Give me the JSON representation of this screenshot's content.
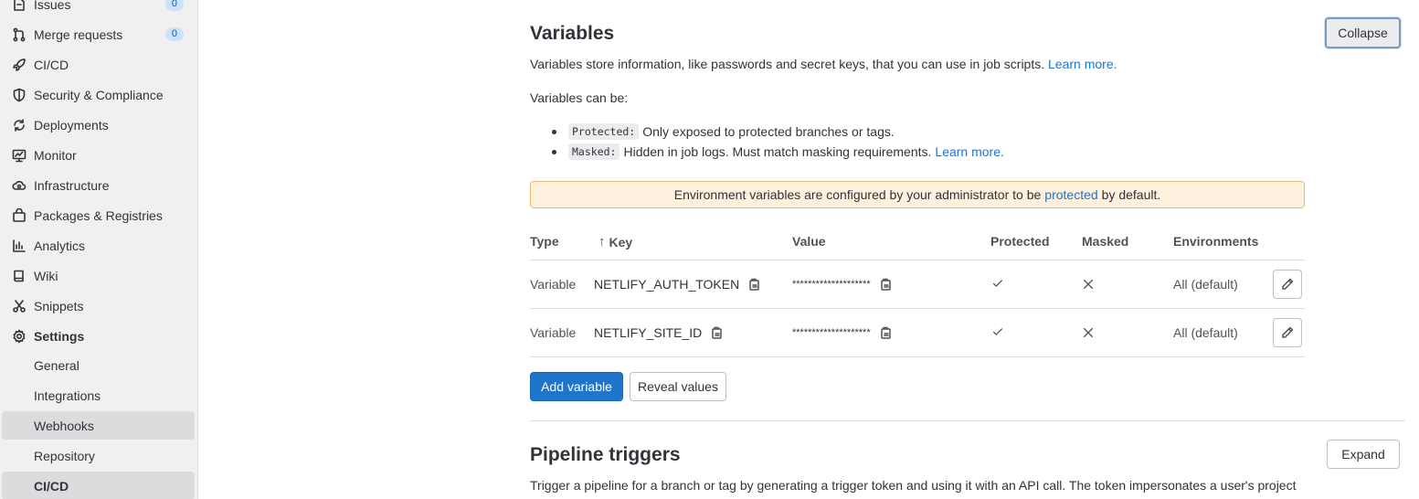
{
  "sidebar": {
    "items": [
      {
        "label": "Issues",
        "icon": "issues-icon",
        "badge": "0"
      },
      {
        "label": "Merge requests",
        "icon": "merge-request-icon",
        "badge": "0"
      },
      {
        "label": "CI/CD",
        "icon": "rocket-icon"
      },
      {
        "label": "Security & Compliance",
        "icon": "shield-icon"
      },
      {
        "label": "Deployments",
        "icon": "deployments-icon"
      },
      {
        "label": "Monitor",
        "icon": "monitor-icon"
      },
      {
        "label": "Infrastructure",
        "icon": "cloud-gear-icon"
      },
      {
        "label": "Packages & Registries",
        "icon": "package-icon"
      },
      {
        "label": "Analytics",
        "icon": "analytics-icon"
      },
      {
        "label": "Wiki",
        "icon": "book-icon"
      },
      {
        "label": "Snippets",
        "icon": "scissors-icon"
      },
      {
        "label": "Settings",
        "icon": "gear-icon"
      }
    ],
    "settings_sub": [
      {
        "label": "General"
      },
      {
        "label": "Integrations"
      },
      {
        "label": "Webhooks"
      },
      {
        "label": "Repository"
      },
      {
        "label": "CI/CD"
      }
    ]
  },
  "variables": {
    "title": "Variables",
    "collapse_label": "Collapse",
    "description": "Variables store information, like passwords and secret keys, that you can use in job scripts.",
    "learn_more": "Learn more.",
    "can_be": "Variables can be:",
    "bullets": [
      {
        "code": "Protected:",
        "text": "Only exposed to protected branches or tags.",
        "link": ""
      },
      {
        "code": "Masked:",
        "text": "Hidden in job logs. Must match masking requirements.",
        "link": "Learn more."
      }
    ],
    "alert": {
      "before": "Environment variables are configured by your administrator to be",
      "link": "protected",
      "after": "by default."
    },
    "columns": {
      "type": "Type",
      "key": "Key",
      "value": "Value",
      "protected": "Protected",
      "masked": "Masked",
      "environments": "Environments"
    },
    "rows": [
      {
        "type": "Variable",
        "key": "NETLIFY_AUTH_TOKEN",
        "value": "********************",
        "protected": true,
        "masked": false,
        "environments": "All (default)"
      },
      {
        "type": "Variable",
        "key": "NETLIFY_SITE_ID",
        "value": "********************",
        "protected": true,
        "masked": false,
        "environments": "All (default)"
      }
    ],
    "add_label": "Add variable",
    "reveal_label": "Reveal values"
  },
  "triggers": {
    "title": "Pipeline triggers",
    "expand_label": "Expand",
    "description": "Trigger a pipeline for a branch or tag by generating a trigger token and using it with an API call. The token impersonates a user's project"
  },
  "colors": {
    "primary": "#1f75cb",
    "alert_bg": "#fdf1dd",
    "sidebar_bg": "#f0f0f0"
  }
}
